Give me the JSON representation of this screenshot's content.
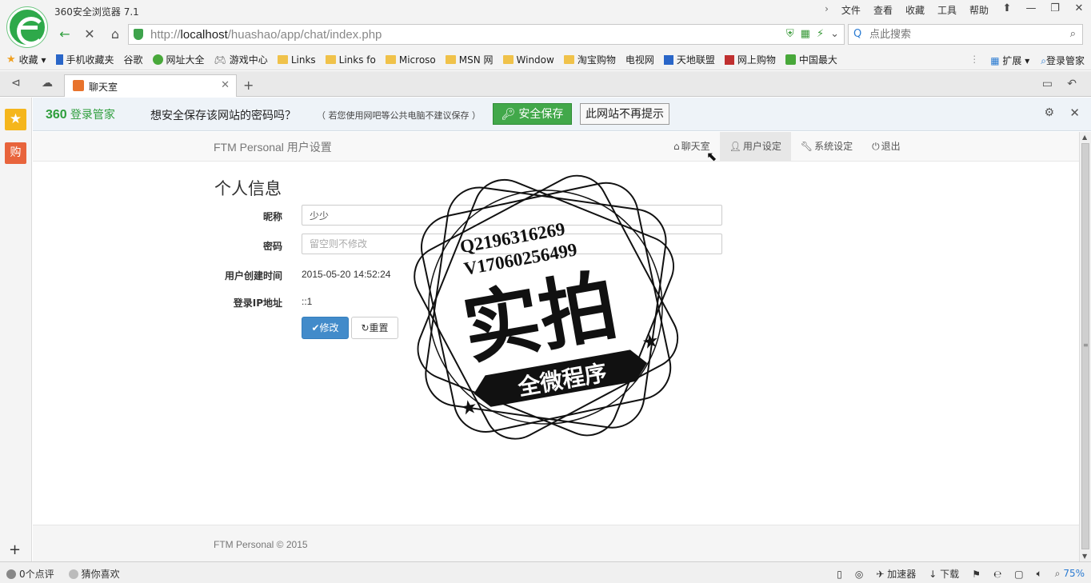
{
  "browser": {
    "title": "360安全浏览器 7.1",
    "menu": [
      "文件",
      "查看",
      "收藏",
      "工具",
      "帮助"
    ],
    "url_prefix": "http://",
    "url_host": "localhost",
    "url_path": "/huashao/app/chat/index.php",
    "search_placeholder": "点此搜索",
    "bookmarks": [
      {
        "label": "收藏",
        "icon": "star-icon"
      },
      {
        "label": "手机收藏夹",
        "icon": "phone-icon"
      },
      {
        "label": "谷歌",
        "icon": "page-icon"
      },
      {
        "label": "网址大全",
        "icon": "green-circle-icon"
      },
      {
        "label": "游戏中心",
        "icon": "gamepad-icon"
      },
      {
        "label": "Links",
        "icon": "folder-icon"
      },
      {
        "label": "Links fo",
        "icon": "folder-icon"
      },
      {
        "label": "Microso",
        "icon": "folder-icon"
      },
      {
        "label": "MSN 网",
        "icon": "folder-icon"
      },
      {
        "label": "Window",
        "icon": "folder-icon"
      },
      {
        "label": "淘宝购物",
        "icon": "folder-icon"
      },
      {
        "label": "电视网",
        "icon": "page-icon"
      },
      {
        "label": "天地联盟",
        "icon": "blue-square-icon"
      },
      {
        "label": "网上购物",
        "icon": "red-square-icon"
      },
      {
        "label": "中国最大",
        "icon": "green-square-icon"
      }
    ],
    "bm_extend": "扩展",
    "bm_login": "登录管家",
    "tab_label": "聊天室",
    "status_left": [
      "0个点评",
      "猜你喜欢"
    ],
    "status_accel": "加速器",
    "status_download": "下载",
    "status_zoom": "75%"
  },
  "pwbar": {
    "logo_num": "360",
    "logo_text": "登录管家",
    "question": "想安全保存该网站的密码吗？",
    "note": "（ 若您使用网吧等公共电脑不建议保存 ）",
    "save_label": "安全保存",
    "never_label": "此网站不再提示"
  },
  "app": {
    "brand": "FTM Personal 用户设置",
    "nav": [
      {
        "label": "聊天室",
        "icon": "home-icon"
      },
      {
        "label": "用户设定",
        "icon": "user-icon"
      },
      {
        "label": "系统设定",
        "icon": "wrench-icon"
      },
      {
        "label": "退出",
        "icon": "power-icon"
      }
    ],
    "heading": "个人信息",
    "nickname_label": "昵称",
    "nickname_value": "少少",
    "password_label": "密码",
    "password_placeholder": "留空则不修改",
    "created_label": "用户创建时间",
    "created_value": "2015-05-20 14:52:24",
    "ip_label": "登录IP地址",
    "ip_value": "::1",
    "submit_label": "修改",
    "reset_label": "重置",
    "footer": "FTM Personal © 2015"
  },
  "watermark": {
    "line1": "Q2196316269",
    "line2": "V17060256499",
    "main": "实拍",
    "banner": "全微程序"
  }
}
